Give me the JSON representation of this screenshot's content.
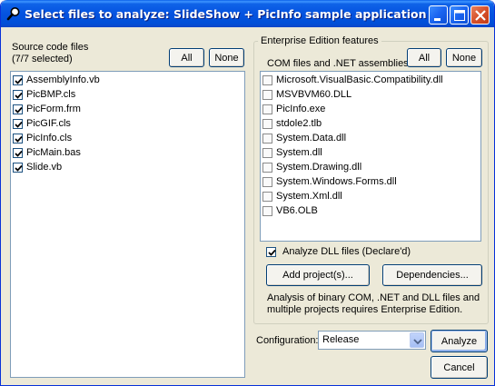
{
  "window": {
    "title": "Select files to analyze: SlideShow + PicInfo sample application"
  },
  "source": {
    "label": "Source code files",
    "count": "(7/7 selected)",
    "all_button": "All",
    "none_button": "None",
    "files": [
      {
        "name": "AssemblyInfo.vb",
        "checked": true
      },
      {
        "name": "PicBMP.cls",
        "checked": true
      },
      {
        "name": "PicForm.frm",
        "checked": true
      },
      {
        "name": "PicGIF.cls",
        "checked": true
      },
      {
        "name": "PicInfo.cls",
        "checked": true
      },
      {
        "name": "PicMain.bas",
        "checked": true
      },
      {
        "name": "Slide.vb",
        "checked": true
      }
    ]
  },
  "enterprise": {
    "group_title": "Enterprise Edition features",
    "com_label": "COM files and .NET assemblies",
    "all_button": "All",
    "none_button": "None",
    "assemblies": [
      {
        "name": "Microsoft.VisualBasic.Compatibility.dll",
        "checked": false
      },
      {
        "name": "MSVBVM60.DLL",
        "checked": false
      },
      {
        "name": "PicInfo.exe",
        "checked": false
      },
      {
        "name": "stdole2.tlb",
        "checked": false
      },
      {
        "name": "System.Data.dll",
        "checked": false
      },
      {
        "name": "System.dll",
        "checked": false
      },
      {
        "name": "System.Drawing.dll",
        "checked": false
      },
      {
        "name": "System.Windows.Forms.dll",
        "checked": false
      },
      {
        "name": "System.Xml.dll",
        "checked": false
      },
      {
        "name": "VB6.OLB",
        "checked": false
      }
    ],
    "analyze_dll_label": "Analyze DLL files (Declare'd)",
    "analyze_dll_checked": true,
    "add_projects_button": "Add project(s)...",
    "dependencies_button": "Dependencies...",
    "note": "Analysis of binary COM, .NET and DLL files and multiple projects requires Enterprise Edition."
  },
  "footer": {
    "configuration_label": "Configuration:",
    "configuration_value": "Release",
    "analyze_button": "Analyze",
    "cancel_button": "Cancel"
  },
  "icons": {
    "title": "magnifier-icon",
    "minimize": "minimize-icon",
    "maximize": "maximize-icon",
    "close": "close-icon"
  }
}
